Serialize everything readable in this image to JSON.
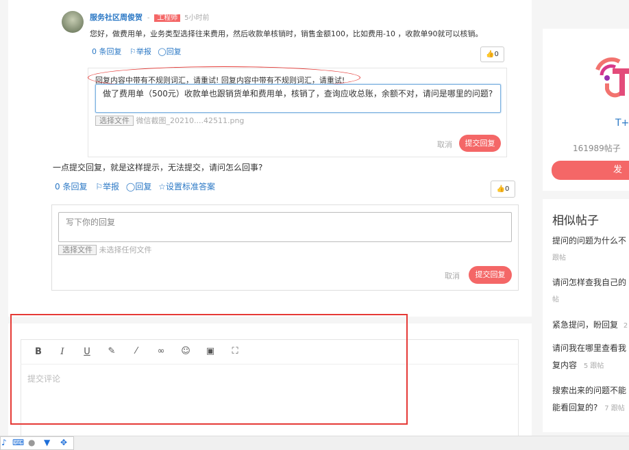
{
  "comment": {
    "author": "服务社区周俊贺",
    "role_badge": "工程师",
    "time": "5小时前",
    "text": "您好，做费用单，业务类型选择往来费用，然后收款单核销时，销售金额100，比如费用-10 ，收款单90就可以核销。",
    "actions": {
      "replies": "0 条回复",
      "report": "举报",
      "reply": "回复"
    },
    "likes": "0"
  },
  "nested_reply": {
    "error": "回复内容中带有不规则词汇，请重试! 回复内容中带有不规则词汇，请重试!",
    "text": "做了费用单（500元）收款单也跟销货单和费用单，核销了，查询应收总账，余额不对，请问是哪里的问题?",
    "file_button": "选择文件",
    "file_name": "微信截图_20210....42511.png",
    "cancel": "取消",
    "submit": "提交回复"
  },
  "answer": {
    "text": "一点提交回复，就是这样提示，无法提交，请问怎么回事?",
    "actions": {
      "replies": "0 条回复",
      "report": "举报",
      "reply": "回复",
      "set_standard": "设置标准答案"
    },
    "likes": "0"
  },
  "reply_box": {
    "placeholder": "写下你的回复",
    "file_button": "选择文件",
    "file_status": "未选择任何文件",
    "cancel": "取消",
    "submit": "提交回复"
  },
  "editor": {
    "placeholder": "提交评论",
    "icons": [
      "bold-icon",
      "italic-icon",
      "underline-icon",
      "pen-icon",
      "brush-icon",
      "link-icon",
      "emoji-icon",
      "image-icon",
      "fullscreen-icon"
    ]
  },
  "sidebar": {
    "brand": "T+",
    "posts": "161989帖子",
    "post_button": "发",
    "similar_title": "相似帖子",
    "similar": [
      {
        "line1": "提问的问题为什么不",
        "meta": "跟帖"
      },
      {
        "line1": "请问怎样查我自己的",
        "meta": "帖"
      },
      {
        "line1": "紧急提问，盼回复",
        "meta": "2"
      },
      {
        "line1": "请问我在哪里查看我",
        "line2": "复内容",
        "meta": "5 跟帖"
      },
      {
        "line1": "搜索出来的问题不能",
        "line2": "能看回复的?",
        "meta": "7 跟帖"
      }
    ]
  },
  "colors": {
    "accent": "#f46767",
    "link": "#2b78c5",
    "annotation": "#e53935"
  }
}
